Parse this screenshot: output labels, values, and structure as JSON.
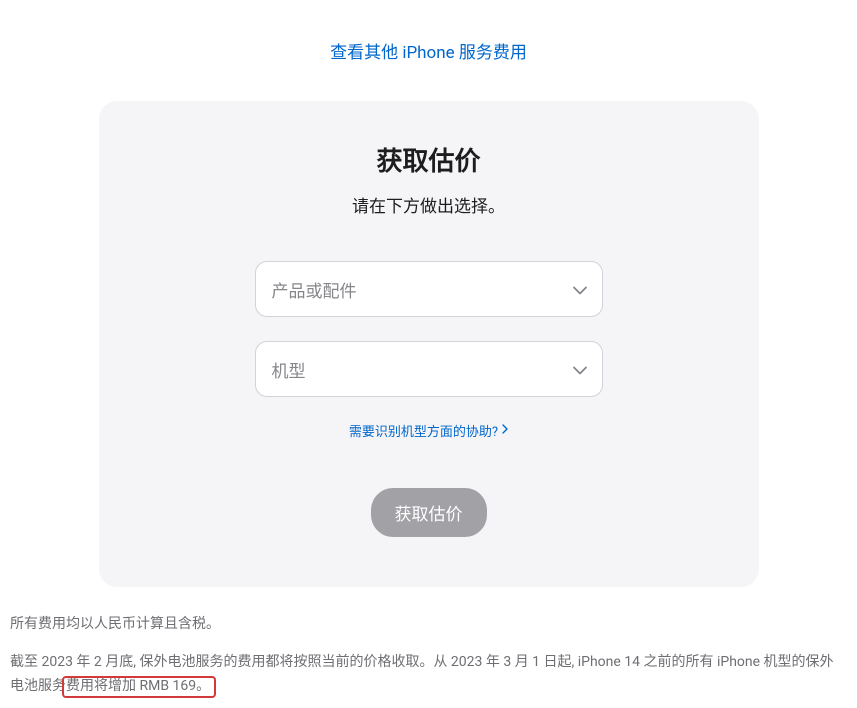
{
  "top_link": "查看其他 iPhone 服务费用",
  "card": {
    "title": "获取估价",
    "subtitle": "请在下方做出选择。",
    "select_product_placeholder": "产品或配件",
    "select_model_placeholder": "机型",
    "help_link": "需要识别机型方面的协助?",
    "submit": "获取估价"
  },
  "footer": {
    "line1": "所有费用均以人民币计算且含税。",
    "line2_prefix": "截至 2023 年 2 月底, 保外电池服务的费用都将按照当前的价格收取。从 2023 年 3 月 1 日起, iPhone 14 之前的所有 iPhone 机型的保外电池服务",
    "line2_highlight": "费用将增加 RMB 169。"
  }
}
